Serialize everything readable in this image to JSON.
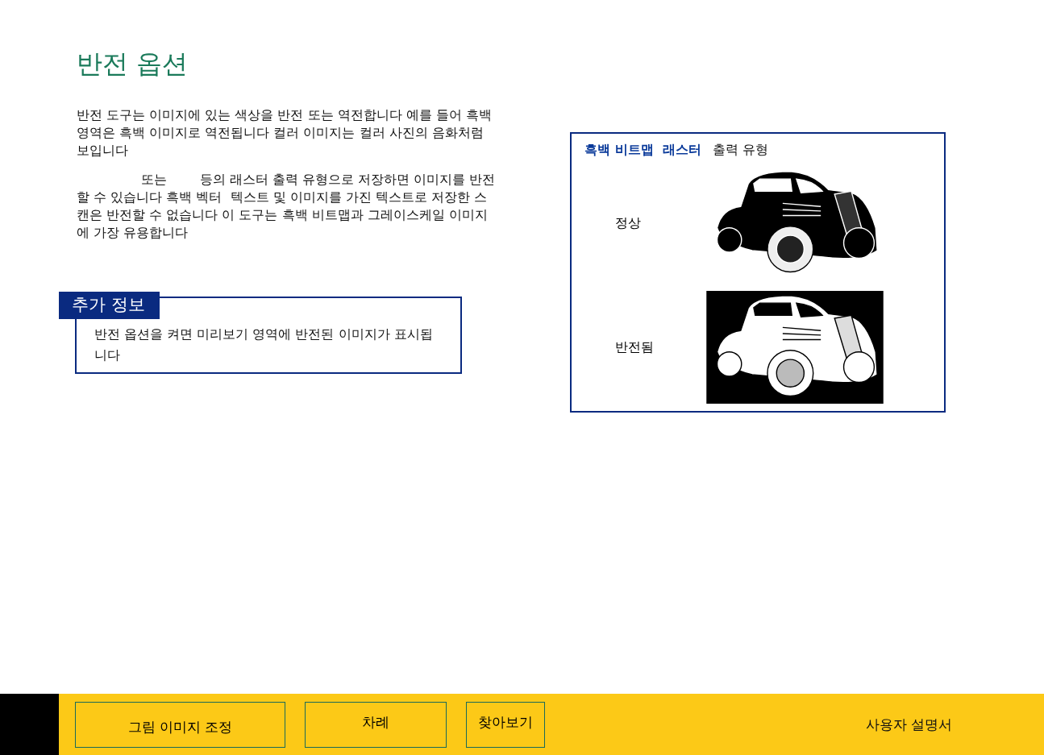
{
  "title": "반전 옵션",
  "paragraphs": [
    "반전 도구는 이미지에 있는 색상을 반전 또는 역전합니다 예를 들어 흑백 영역은 흑백 이미지로 역전됩니다 컬러 이미지는 컬러 사진의 음화처럼 보입니다",
    "또는        등의 래스터 출력 유형으로 저장하면 이미지를 반전할 수 있습니다 흑백 벡터  텍스트 및 이미지를 가진 텍스트로 저장한 스캔은 반전할 수 없습니다 이 도구는 흑백 비트맵과 그레이스케일 이미지에 가장 유용합니다"
  ],
  "info_box": {
    "heading": "추가 정보",
    "text": "반전 옵션을 켜면 미리보기 영역에 반전된 이미지가 표시됩니다"
  },
  "figure": {
    "caption_highlight": "흑백 비트맵  래스터",
    "caption_rest": "출력 유형",
    "examples": [
      {
        "label": "정상",
        "inverted": false
      },
      {
        "label": "반전됨",
        "inverted": true
      }
    ]
  },
  "footer": {
    "buttons": [
      "그림 이미지 조정",
      "차례",
      "찾아보기"
    ],
    "manual_title": "사용자 설명서"
  }
}
